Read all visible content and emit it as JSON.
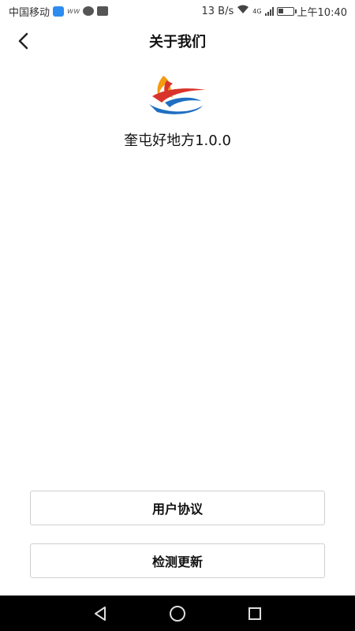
{
  "status_bar": {
    "carrier": "中国移动",
    "speed": "13 B/s",
    "network": "4G",
    "time": "上午10:40",
    "icons": [
      "shield-icon",
      "ww-icon",
      "chat-icon",
      "ai-icon",
      "wifi-icon",
      "signal-icon",
      "battery-icon"
    ]
  },
  "header": {
    "title": "关于我们",
    "back_icon": "chevron-left-icon"
  },
  "about": {
    "logo_icon": "app-logo",
    "app_name": "奎屯好地方1.0.0"
  },
  "buttons": {
    "agreement_label": "用户协议",
    "update_label": "检测更新"
  },
  "nav_bar": {
    "icons": [
      "back-triangle-icon",
      "home-circle-icon",
      "recents-square-icon"
    ]
  },
  "colors": {
    "accent_blue": "#2d8cf0",
    "logo_red": "#d9342b",
    "logo_orange": "#f39c12",
    "logo_blue": "#1f6fc1"
  }
}
